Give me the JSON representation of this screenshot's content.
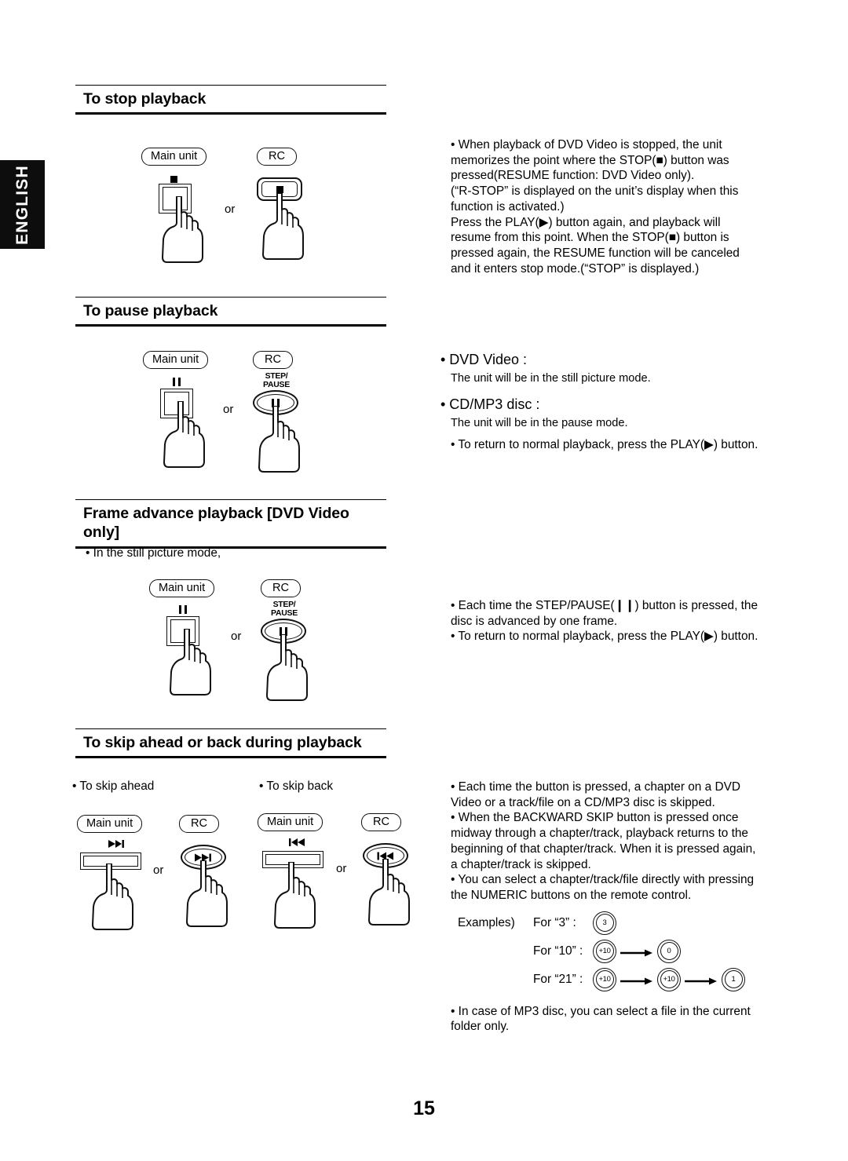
{
  "page": {
    "language_tab": "ENGLISH",
    "page_number": "15"
  },
  "labels": {
    "main_unit": "Main unit",
    "rc": "RC",
    "or": "or",
    "step_line1": "STEP/",
    "step_line2": "PAUSE"
  },
  "sections": [
    {
      "id": "stop",
      "heading": "To stop playback",
      "right_text": [
        "• When playback of DVD Video is stopped, the unit",
        "memorizes the point where the STOP(■) button was",
        "pressed(RESUME function: DVD Video only).",
        "(“R-STOP” is displayed on the unit’s display when this",
        "function is activated.)",
        "Press the PLAY(▶) button again, and playback will",
        "resume from this point. When the STOP(■) button is",
        "pressed again, the RESUME function will be canceled",
        "and it enters stop mode.(“STOP” is displayed.)"
      ]
    },
    {
      "id": "pause",
      "heading": "To pause playback",
      "right_blocks": [
        {
          "type": "big",
          "text": "• DVD Video :"
        },
        {
          "type": "sub",
          "text": "The unit will be in the still picture mode."
        },
        {
          "type": "big",
          "text": "• CD/MP3 disc :"
        },
        {
          "type": "sub",
          "text": "The unit will be in the pause mode."
        },
        {
          "type": "bullet",
          "text": "• To return to normal playback, press the PLAY(▶) button."
        }
      ]
    },
    {
      "id": "frame-advance",
      "heading": "Frame advance playback [DVD Video only]",
      "left_note": "• In the still picture mode,",
      "right_text": [
        "• Each time the STEP/PAUSE(❙❙) button is pressed, the",
        "disc is advanced by one frame.",
        "• To return to normal playback, press the PLAY(▶) button."
      ]
    },
    {
      "id": "skip",
      "heading": "To skip ahead or back during playback",
      "left_captions": [
        "• To skip ahead",
        "• To skip back"
      ],
      "right_text": [
        "• Each time the button is pressed, a chapter on a DVD",
        "Video or a track/file on a CD/MP3 disc is skipped.",
        "• When the BACKWARD SKIP button is pressed once",
        "midway through a chapter/track, playback returns to the",
        "beginning of that chapter/track. When it is pressed again,",
        "a chapter/track is skipped.",
        "• You can select a chapter/track/file directly with pressing",
        "the NUMERIC buttons on the remote control."
      ],
      "examples_label": "Examples)",
      "examples": [
        {
          "for": "For “3” :",
          "keys": [
            "3"
          ]
        },
        {
          "for": "For “10” :",
          "keys": [
            "+10",
            "0"
          ]
        },
        {
          "for": "For “21” :",
          "keys": [
            "+10",
            "+10",
            "1"
          ]
        }
      ],
      "footer_text": [
        "• In case of MP3 disc, you can select a file in the current",
        "folder only."
      ]
    }
  ]
}
